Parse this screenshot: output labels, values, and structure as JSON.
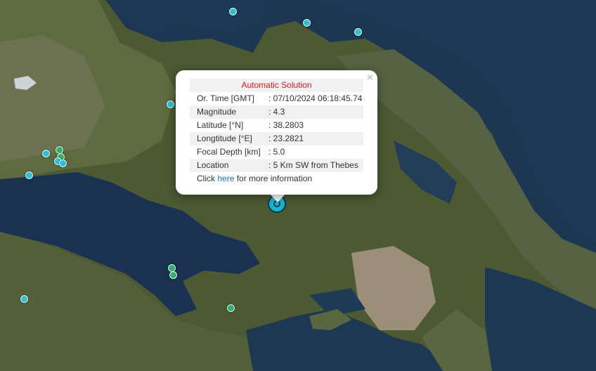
{
  "popup": {
    "title": "Automatic Solution",
    "close_glyph": "×",
    "rows": [
      {
        "label": "Or. Time [GMT]",
        "value": ": 07/10/2024 06:18:45.74"
      },
      {
        "label": "Magnitude",
        "value": ": 4.3"
      },
      {
        "label": "Latitude [°N]",
        "value": ": 38.2803"
      },
      {
        "label": "Longtitude [°E]",
        "value": ": 23.2821"
      },
      {
        "label": "Focal Depth [km]",
        "value": ": 5.0"
      },
      {
        "label": "Location",
        "value": ": 5 Km SW from Thebes"
      }
    ],
    "footer_prefix": "Click ",
    "footer_link": "here",
    "footer_suffix": " for more information"
  },
  "colors": {
    "cyan_marker": "#2ec0d6",
    "green_marker": "#2fb36a",
    "title_red": "#e0191f",
    "link_blue": "#0b78c6"
  }
}
